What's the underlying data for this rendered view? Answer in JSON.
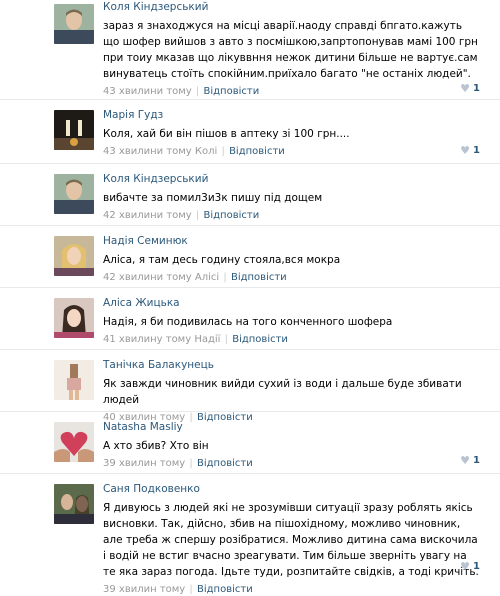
{
  "reply_label": "Відповісти",
  "comments": [
    {
      "author": "Коля Кіндзерський",
      "text": "зараз я знаходжуся на місці аварії.наоду справді бпгато.кажуть що шофер вийшов з авто з посмішкою,запртопонував мамі 100 грн при тоиу мказав що лікуввння нежок дитини більше не вартує.сам винуватець стоїть спокійним.приїхало багато \"не останіх людей\".",
      "time": "43 хвилини тому",
      "reply_to": "",
      "likes": "1"
    },
    {
      "author": "Марія Гудз",
      "text": "Коля, хай би він пішов в аптеку зі 100 грн....",
      "time": "43 хвилини тому",
      "reply_to": "Колі",
      "likes": "1"
    },
    {
      "author": "Коля Кіндзерський",
      "text": "вибачте за помил3и3к пишу під дощем",
      "time": "42 хвилини тому",
      "reply_to": "",
      "likes": ""
    },
    {
      "author": "Надія Семинюк",
      "text": "Аліса, я там десь годину стояла,вся мокра",
      "time": "42 хвилини тому",
      "reply_to": "Алісі",
      "likes": ""
    },
    {
      "author": "Аліса Жицька",
      "text": "Надія, я би подивилась на того конченного шофера",
      "time": "41 хвилину тому",
      "reply_to": "Надії",
      "likes": ""
    },
    {
      "author": "Танічка Балакунець",
      "text": "Як завжди чиновник вийди сухий із води і дальше буде збивати людей",
      "time": "40 хвилин тому",
      "reply_to": "",
      "likes": ""
    },
    {
      "author": "Natasha Masliy",
      "text": "А хто збив? Хто він",
      "time": "39 хвилин тому",
      "reply_to": "",
      "likes": "1"
    },
    {
      "author": "Саня Подковенко",
      "text": "Я дивуюсь з людей які не зрозумівши ситуації зразу роблять якісь висновки. Так, дійсно, збив на пішохідному, можливо чиновник, але треба ж спершу розібратися. Можливо дитина сама вискочила і водій не встиг вчасно зреагувати. Тим більше зверніть увагу на те яка зараз погода. Ідьте туди, розпитайте свідків, а тоді кричіть.",
      "time": "39 хвилин тому",
      "reply_to": "",
      "likes": "1"
    }
  ]
}
